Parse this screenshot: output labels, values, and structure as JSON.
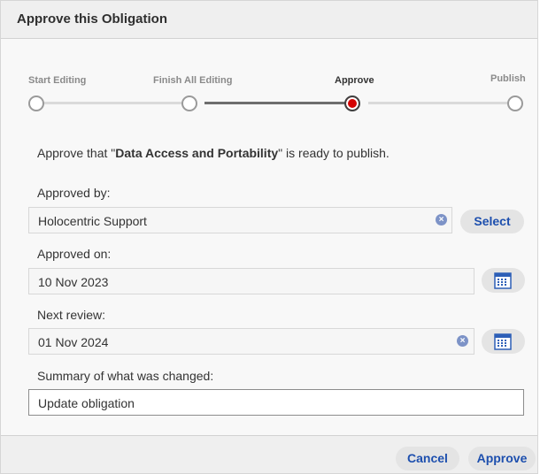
{
  "dialog": {
    "title": "Approve this Obligation"
  },
  "stepper": {
    "steps": [
      {
        "label": "Start Editing"
      },
      {
        "label": "Finish All Editing"
      },
      {
        "label": "Approve"
      },
      {
        "label": "Publish"
      }
    ],
    "current_step": "Approve"
  },
  "message": {
    "prefix": "Approve that ",
    "quote_open": "\"",
    "name": "Data Access and Portability",
    "quote_close": "\"",
    "suffix": " is ready to publish."
  },
  "approved_by": {
    "label": "Approved by:",
    "value": "Holocentric Support",
    "select_label": "Select"
  },
  "approved_on": {
    "label": "Approved on:",
    "value": "10 Nov 2023"
  },
  "next_review": {
    "label": "Next review:",
    "value": "01 Nov 2024"
  },
  "summary": {
    "label": "Summary of what was changed:",
    "value": "Update obligation"
  },
  "footer": {
    "cancel_label": "Cancel",
    "approve_label": "Approve"
  },
  "colors": {
    "accent": "#1d4fae",
    "active_step": "#d40000",
    "clear_icon": "#7d93c7"
  },
  "icons": {
    "clear": "clear-icon",
    "calendar": "calendar-icon"
  }
}
